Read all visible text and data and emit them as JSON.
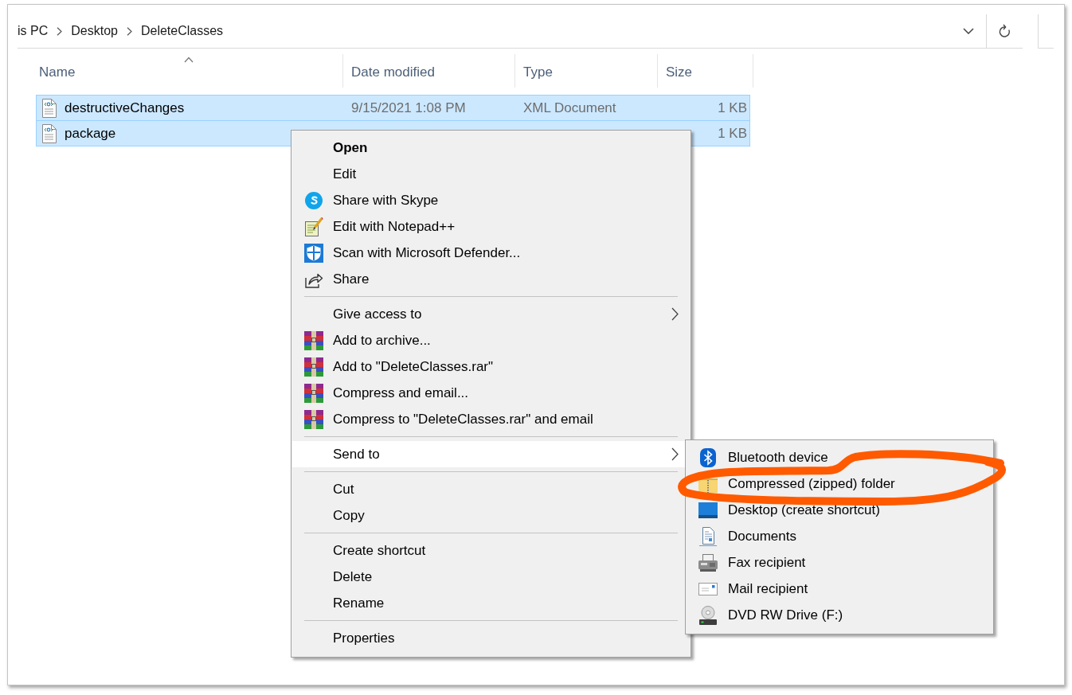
{
  "address_bar": {
    "breadcrumbs": [
      "is PC",
      "Desktop",
      "DeleteClasses"
    ]
  },
  "file_list": {
    "columns": [
      {
        "label": "Name",
        "sorted": true
      },
      {
        "label": "Date modified",
        "sorted": false
      },
      {
        "label": "Type",
        "sorted": false
      },
      {
        "label": "Size",
        "sorted": false
      }
    ],
    "rows": [
      {
        "name": "destructiveChanges",
        "date_modified": "9/15/2021 1:08 PM",
        "type": "XML Document",
        "size": "1 KB",
        "selected": true
      },
      {
        "name": "package",
        "size": "1 KB",
        "selected": true
      }
    ]
  },
  "context_menu": {
    "groups": [
      [
        {
          "label": "Open",
          "default": true,
          "selected": false,
          "submenu": false
        },
        {
          "label": "Edit",
          "default": false,
          "selected": false,
          "submenu": false
        },
        {
          "label": "Share with Skype",
          "default": false,
          "selected": false,
          "submenu": false
        },
        {
          "label": "Edit with Notepad++",
          "default": false,
          "selected": false,
          "submenu": false
        },
        {
          "label": "Scan with Microsoft Defender...",
          "default": false,
          "selected": false,
          "submenu": false
        },
        {
          "label": "Share",
          "default": false,
          "selected": false,
          "submenu": false
        }
      ],
      [
        {
          "label": "Give access to",
          "default": false,
          "selected": false,
          "submenu": true
        },
        {
          "label": "Add to archive...",
          "default": false,
          "selected": false,
          "submenu": false
        },
        {
          "label": "Add to \"DeleteClasses.rar\"",
          "default": false,
          "selected": false,
          "submenu": false
        },
        {
          "label": "Compress and email...",
          "default": false,
          "selected": false,
          "submenu": false
        },
        {
          "label": "Compress to \"DeleteClasses.rar\" and email",
          "default": false,
          "selected": false,
          "submenu": false
        }
      ],
      [
        {
          "label": "Send to",
          "default": false,
          "selected": true,
          "submenu": true
        }
      ],
      [
        {
          "label": "Cut",
          "default": false,
          "selected": false,
          "submenu": false
        },
        {
          "label": "Copy",
          "default": false,
          "selected": false,
          "submenu": false
        }
      ],
      [
        {
          "label": "Create shortcut",
          "default": false,
          "selected": false,
          "submenu": false
        },
        {
          "label": "Delete",
          "default": false,
          "selected": false,
          "submenu": false
        },
        {
          "label": "Rename",
          "default": false,
          "selected": false,
          "submenu": false
        }
      ],
      [
        {
          "label": "Properties",
          "default": false,
          "selected": false,
          "submenu": false
        }
      ]
    ]
  },
  "send_to_menu": {
    "items": [
      {
        "label": "Bluetooth device",
        "selected": false,
        "circled": false
      },
      {
        "label": "Compressed (zipped) folder",
        "selected": false,
        "circled": true
      },
      {
        "label": "Desktop (create shortcut)",
        "selected": false,
        "circled": false
      },
      {
        "label": "Documents",
        "selected": false,
        "circled": false
      },
      {
        "label": "Fax recipient",
        "selected": false,
        "circled": false
      },
      {
        "label": "Mail recipient",
        "selected": false,
        "circled": false
      },
      {
        "label": "DVD RW Drive (F:)",
        "selected": false,
        "circled": false
      }
    ]
  }
}
